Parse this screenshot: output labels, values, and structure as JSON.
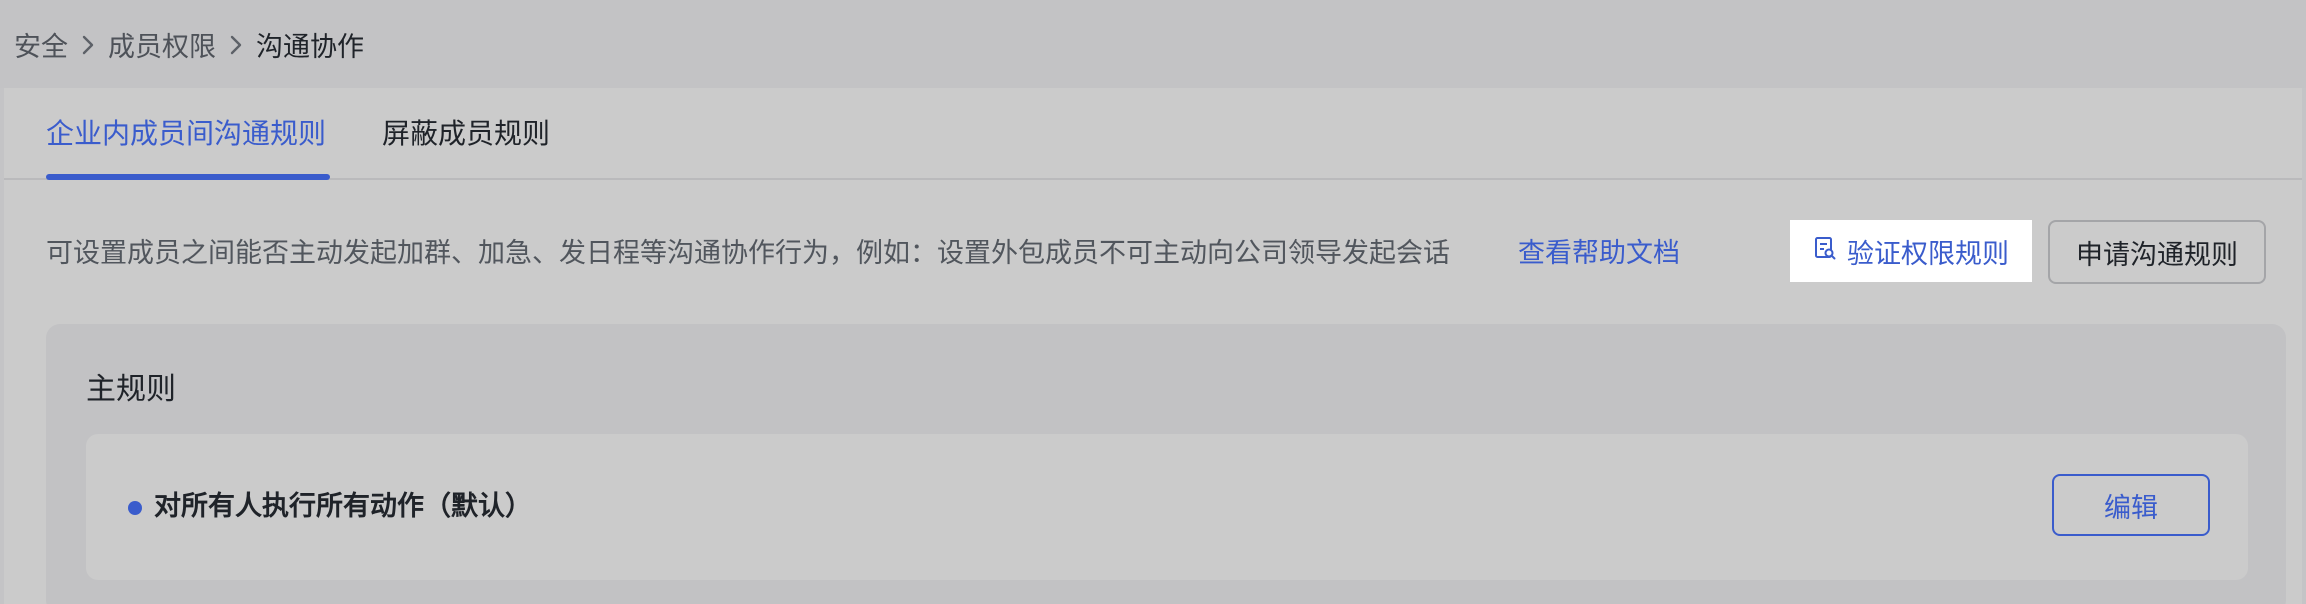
{
  "breadcrumb": {
    "items": [
      "安全",
      "成员权限",
      "沟通协作"
    ]
  },
  "tabs": [
    {
      "label": "企业内成员间沟通规则",
      "active": true
    },
    {
      "label": "屏蔽成员规则",
      "active": false
    }
  ],
  "description": {
    "text": "可设置成员之间能否主动发起加群、加急、发日程等沟通协作行为，例如：设置外包成员不可主动向公司领导发起会话",
    "help_link": "查看帮助文档"
  },
  "actions": {
    "verify_label": "验证权限规则",
    "apply_label": "申请沟通规则"
  },
  "main_rules": {
    "title": "主规则",
    "items": [
      {
        "text": "对所有人执行所有动作（默认）",
        "edit_label": "编辑"
      }
    ]
  },
  "colors": {
    "accent": "#3a5ccc",
    "text": "#1f2329",
    "muted": "#51565d"
  }
}
